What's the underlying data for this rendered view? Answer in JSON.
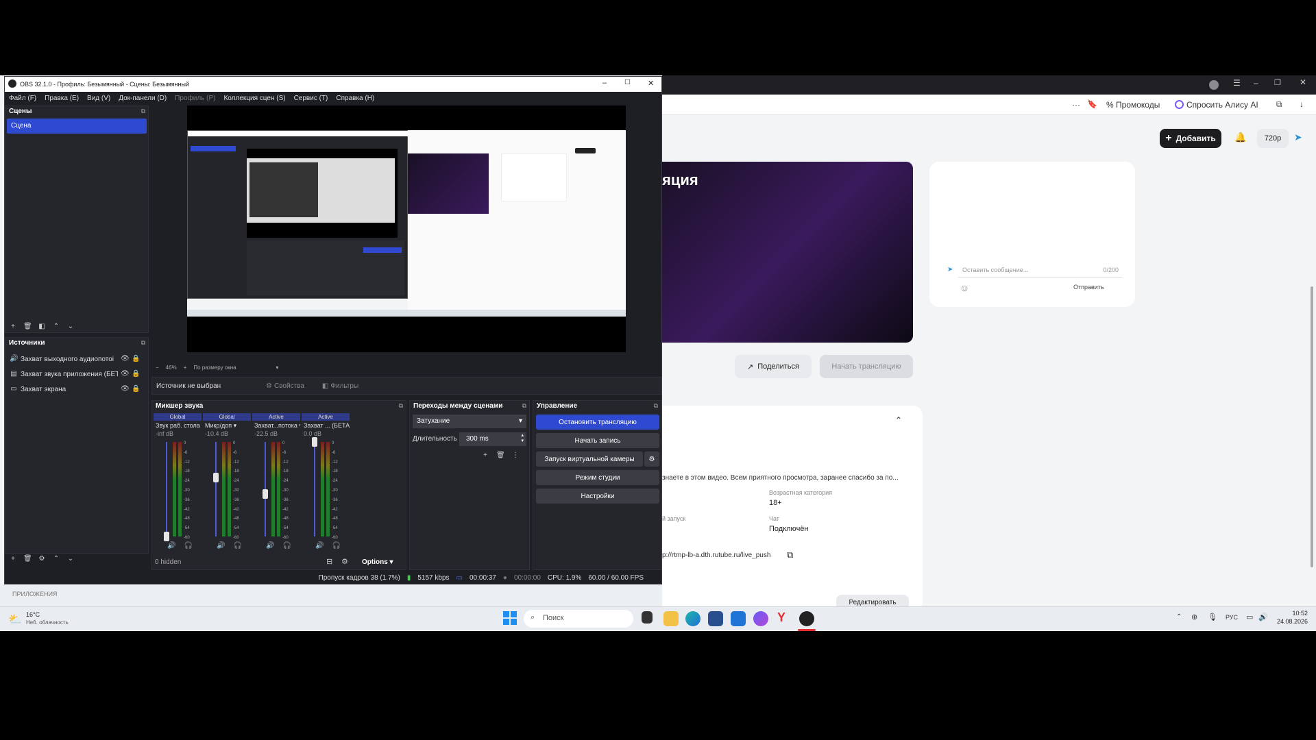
{
  "obs": {
    "title": "OBS 32.1.0 - Профиль: Безымянный - Сцены: Безымянный",
    "menu": [
      "Файл (F)",
      "Правка (E)",
      "Вид (V)",
      "Док-панели (D)",
      "Профиль (P)",
      "Коллекция сцен (S)",
      "Сервис (T)",
      "Справка (H)"
    ],
    "scenes": {
      "header": "Сцены",
      "items": [
        "Сцена"
      ]
    },
    "sources": {
      "header": "Источники",
      "items": [
        "Захват выходного аудиопотоі",
        "Захват звука приложения (БЕТ",
        "Захват экрана"
      ]
    },
    "preview": {
      "zoom": "46%",
      "scale_mode": "По размеру окна",
      "no_source": "Источник не выбран",
      "properties": "Свойства",
      "filters": "Фильтры"
    },
    "mixer": {
      "header": "Микшер звука",
      "channels": [
        {
          "tag": "Global",
          "name": "Звук раб. стола",
          "db": "-inf dB",
          "level": 0.0
        },
        {
          "tag": "Global",
          "name": "Микр/доп",
          "db": "-10.4 dB",
          "level": 0.62
        },
        {
          "tag": "Active",
          "name": "Захват...потока",
          "db": "-22.5 dB",
          "level": 0.45
        },
        {
          "tag": "Active",
          "name": "Захват ... (БЕТА)",
          "db": "0.0 dB",
          "level": 1.0
        }
      ],
      "scale": [
        "0",
        "-6",
        "-12",
        "-18",
        "-24",
        "-30",
        "-36",
        "-42",
        "-48",
        "-54",
        "-60"
      ],
      "hidden": "0 hidden",
      "options": "Options"
    },
    "transitions": {
      "header": "Переходы между сценами",
      "type": "Затухание",
      "duration_label": "Длительность",
      "duration": "300 ms"
    },
    "controls": {
      "header": "Управление",
      "stop_stream": "Остановить трансляцию",
      "start_record": "Начать запись",
      "virtual_cam": "Запуск виртуальной камеры",
      "studio_mode": "Режим студии",
      "settings": "Настройки"
    },
    "status": {
      "dropped": "Пропуск кадров 38 (1.7%)",
      "bitrate": "5157 kbps",
      "stream_time": "00:00:37",
      "rec_time": "00:00:00",
      "cpu": "CPU: 1.9%",
      "fps": "60.00 / 60.00 FPS"
    },
    "colors": {
      "accent": "#2f4ad0",
      "bg": "#1e1f24"
    }
  },
  "browser": {
    "toolbar": {
      "promocodes": "Промокоды",
      "alice": "Спросить Алису AI"
    },
    "header": {
      "add": "Добавить",
      "quality": "720p"
    },
    "video_title": "яция",
    "chat": {
      "placeholder": "Оставить сообщение...",
      "counter": "0/200",
      "send": "Отправить"
    },
    "share": "Поделиться",
    "start_stream": "Начать трансляцию",
    "info": {
      "desc": "знаете в этом видео. Всем приятного просмотра, заранее спасибо за по...",
      "age_label": "Возрастная категория",
      "age": "18+",
      "launch_label": "й запуск",
      "chat_label": "Чат",
      "chat_value": "Подключён",
      "url": "p://rtmp-lb-a.dth.rutube.ru/live_push",
      "edit": "Редактировать"
    },
    "apps_label": "ПРИЛОЖЕНИЯ"
  },
  "taskbar": {
    "weather_temp": "16°C",
    "weather_desc": "Неб. облачность",
    "search": "Поиск",
    "lang": "РУС",
    "time": "10:52",
    "date": "24.08.2026"
  }
}
